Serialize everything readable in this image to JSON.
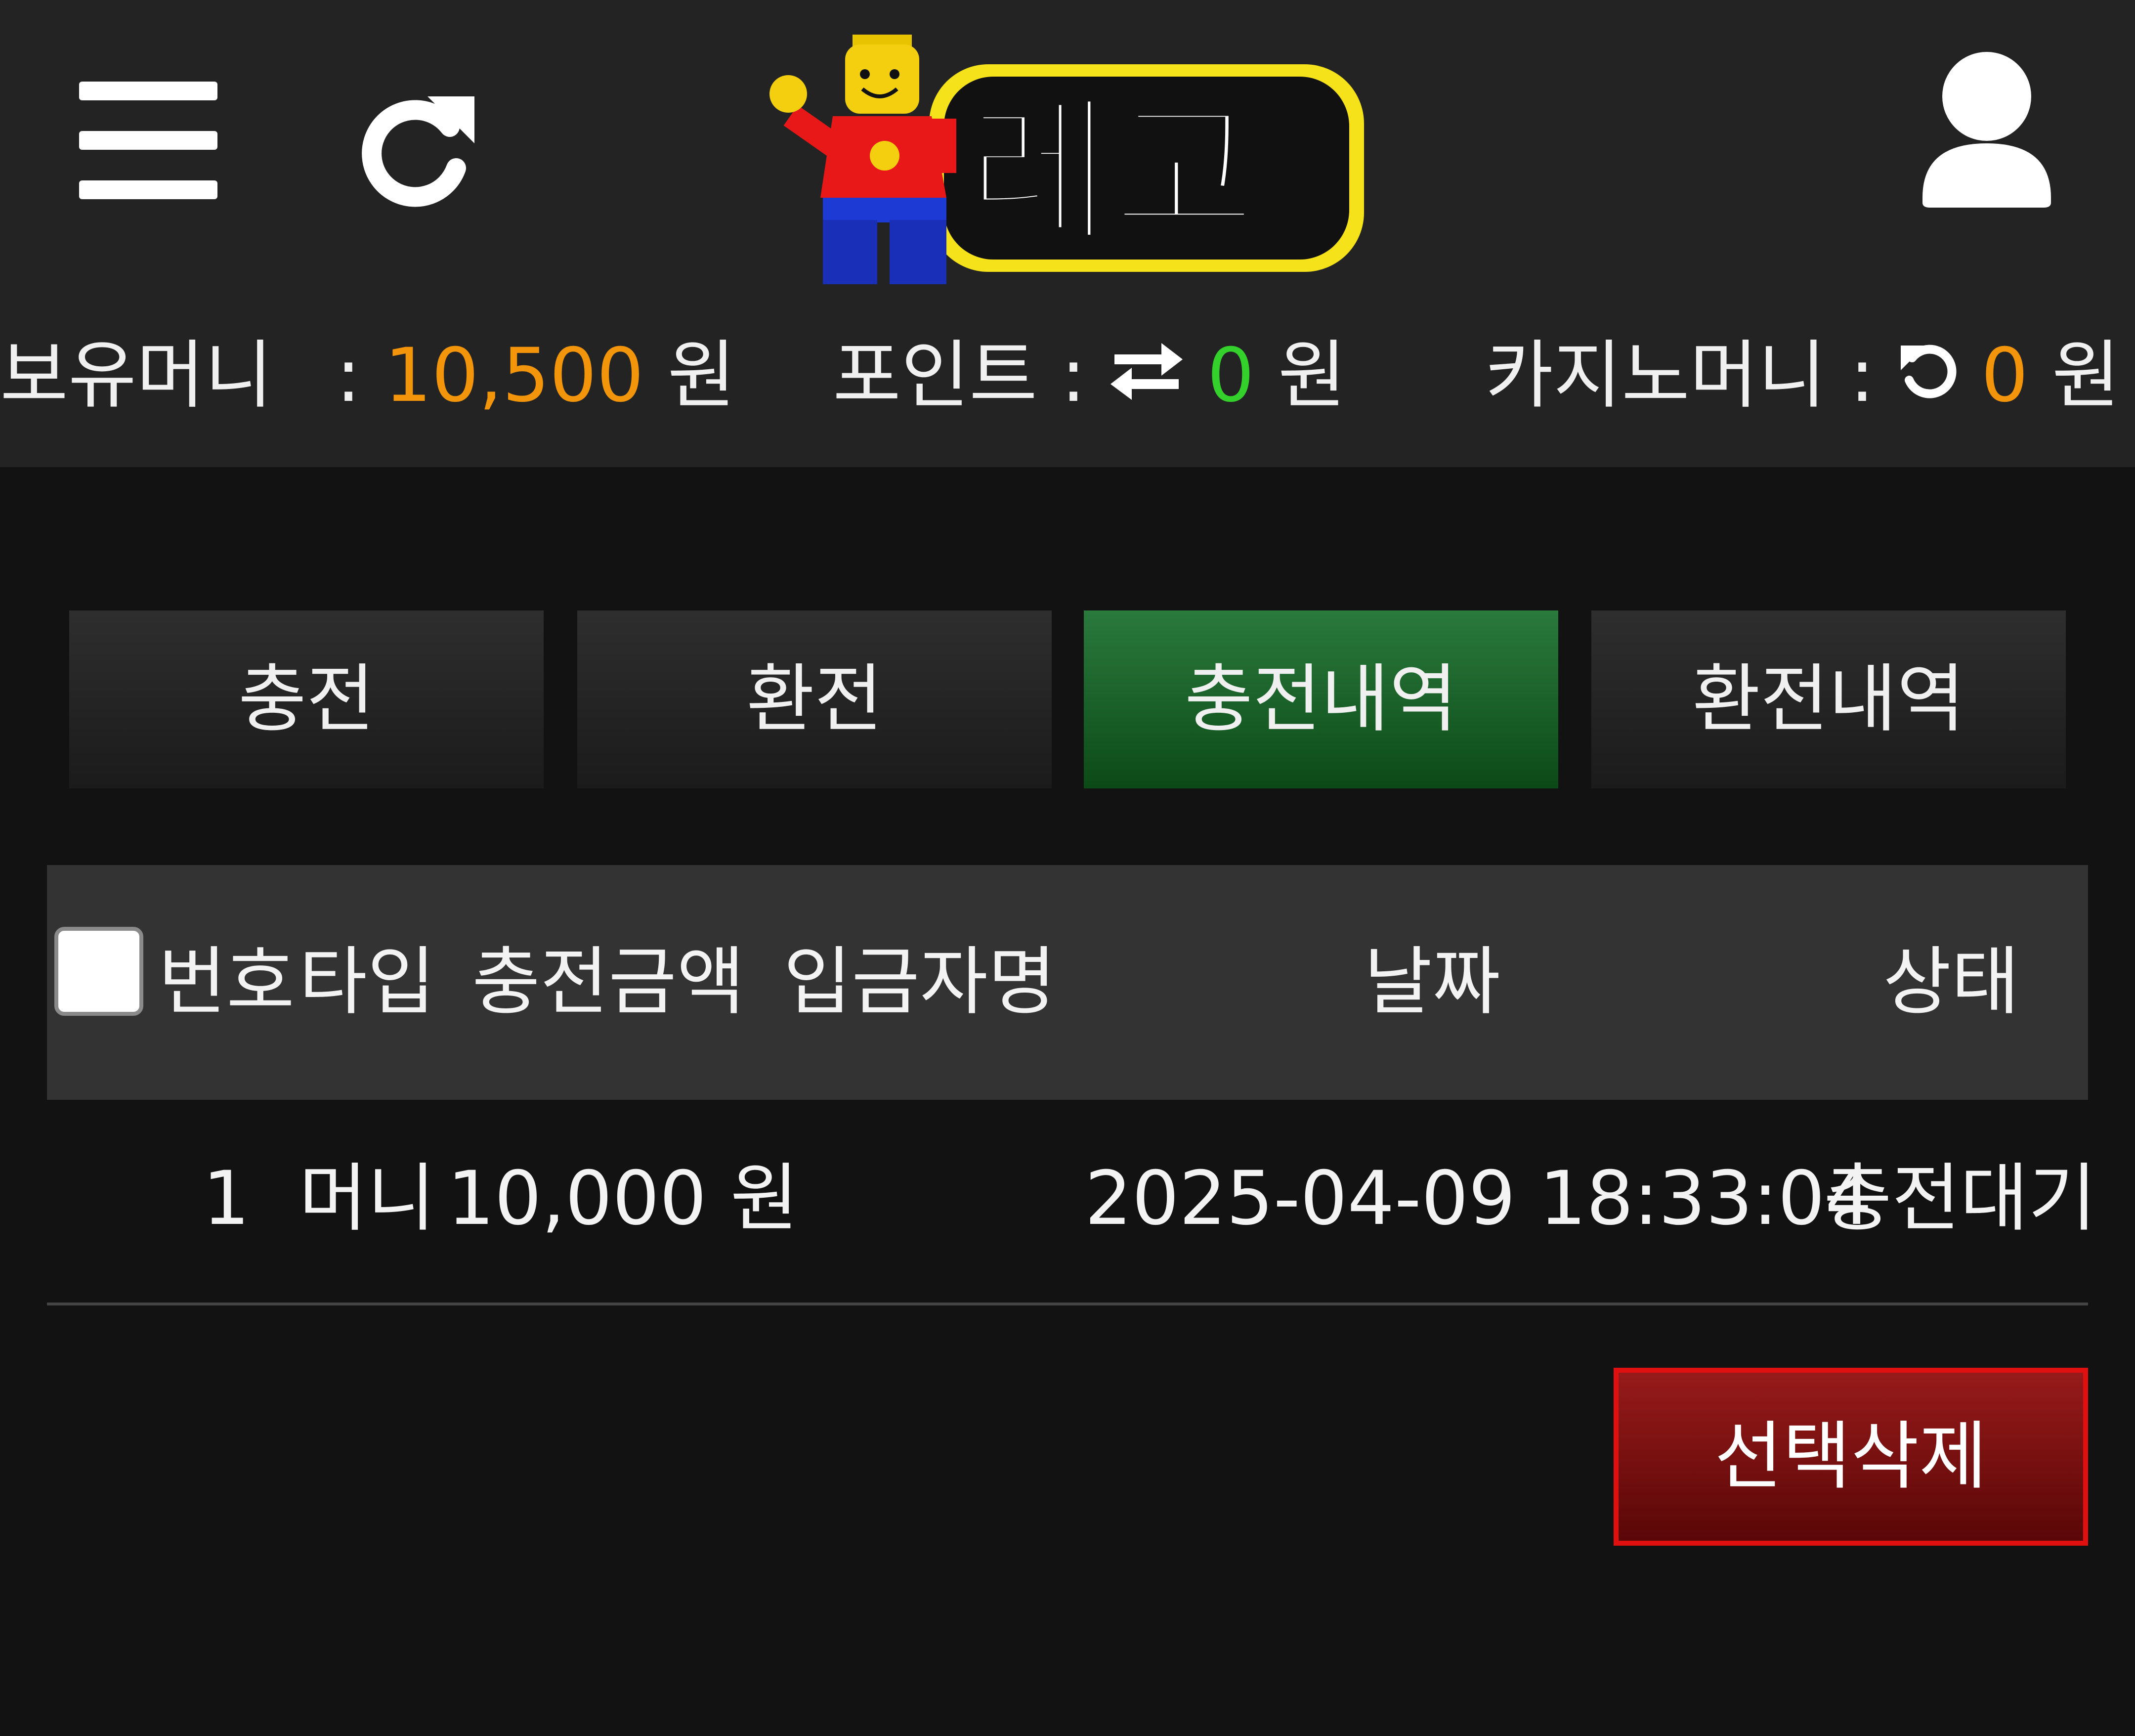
{
  "header": {
    "logo_text": "레고",
    "icons": {
      "menu": "hamburger-menu-icon",
      "refresh": "refresh-icon",
      "user": "user-profile-icon",
      "transfer": "transfer-arrows-icon",
      "casino_refresh": "counterclockwise-refresh-icon"
    }
  },
  "balances": {
    "money": {
      "label": "보유머니",
      "colon": ":",
      "value": "10,500",
      "unit": "원"
    },
    "point": {
      "label": "포인트 :",
      "value": "0",
      "unit": "원"
    },
    "casino": {
      "label": "카지노머니 :",
      "value": "0",
      "unit": "원"
    }
  },
  "tabs": [
    {
      "label": "충전",
      "active": false
    },
    {
      "label": "환전",
      "active": false
    },
    {
      "label": "충전내역",
      "active": true
    },
    {
      "label": "환전내역",
      "active": false
    }
  ],
  "table": {
    "columns": [
      "번호",
      "타입",
      "충전금액",
      "입금자명",
      "날짜",
      "상태"
    ],
    "rows": [
      {
        "no": "1",
        "type": "머니",
        "amount": "10,000 원",
        "depositor": "",
        "date": "2025-04-09 18:33:04",
        "status": "충전대기"
      }
    ]
  },
  "actions": {
    "delete_selected": "선택삭제"
  },
  "colors": {
    "header_bg": "#232323",
    "page_bg": "#121212",
    "accent_orange": "#f3950a",
    "accent_green": "#34d02c",
    "active_tab": "#1e6a30",
    "delete_red": "#c01515"
  }
}
